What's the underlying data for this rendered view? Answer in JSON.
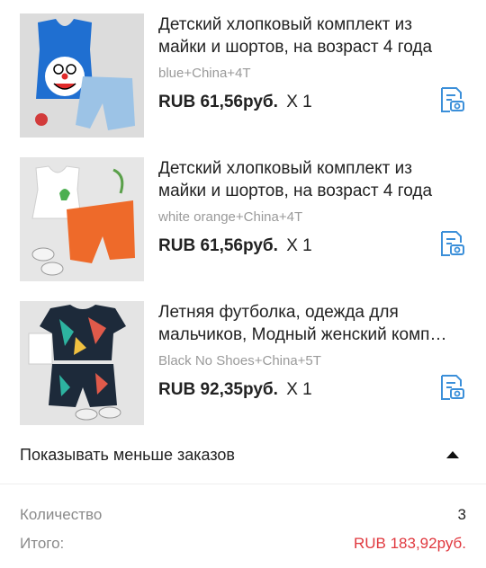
{
  "items": [
    {
      "title": "Детский хлопковый комплект из майки и шортов, на возраст 4 года",
      "variant": "blue+China+4T",
      "price": "RUB 61,56руб.",
      "quantity": "X 1",
      "image_icon": "blue-doraemon-tank-top-and-denim-shorts-photo"
    },
    {
      "title": "Детский хлопковый комплект из майки и шортов, на возраст 4 года",
      "variant": "white orange+China+4T",
      "price": "RUB 61,56руб.",
      "quantity": "X 1",
      "image_icon": "white-tank-top-and-orange-shorts-photo"
    },
    {
      "title": "Летняя футболка, одежда для мальчиков, Модный женский комп…",
      "variant": "Black No Shoes+China+5T",
      "price": "RUB 92,35руб.",
      "quantity": "X 1",
      "image_icon": "black-tropical-print-shirt-and-shorts-photo"
    }
  ],
  "toggle": {
    "label": "Показывать меньше заказов",
    "icon": "caret-up-icon"
  },
  "summary": {
    "quantity_label": "Количество",
    "quantity_value": "3",
    "total_label": "Итого:",
    "total_value": "RUB 183,92руб."
  },
  "colors": {
    "accent_blue": "#3b8fd9",
    "total_red": "#e0383e",
    "muted_text": "#9a9a9a"
  }
}
